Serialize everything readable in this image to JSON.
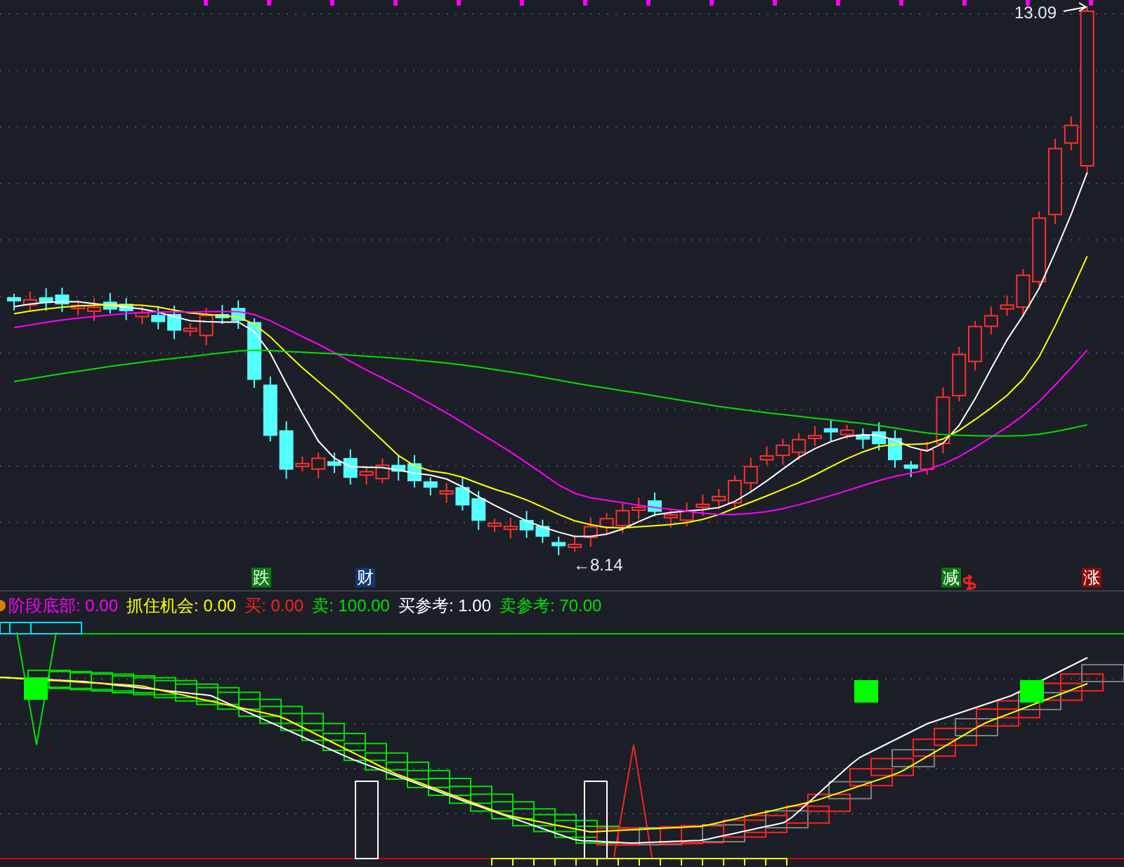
{
  "main_chart": {
    "high_label": "13.09",
    "low_label": "←8.14",
    "signals": [
      {
        "text": "跌",
        "color": "#0b7a10"
      },
      {
        "text": "财",
        "color": "#0e3a6e"
      },
      {
        "text": "减",
        "color": "#0b7a10"
      },
      {
        "text": "涨",
        "color": "#8a0c0c"
      }
    ]
  },
  "indicator": {
    "legend": [
      {
        "text": "阶段底部: 0.00",
        "color": "#ff00ff"
      },
      {
        "text": "抓住机会: 0.00",
        "color": "#ffff00"
      },
      {
        "text": "买: 0.00",
        "color": "#ff2020"
      },
      {
        "text": "卖: 100.00",
        "color": "#00e000"
      },
      {
        "text": "买参考: 1.00",
        "color": "#ffffff"
      },
      {
        "text": "卖参考: 70.00",
        "color": "#00e000"
      }
    ]
  }
}
